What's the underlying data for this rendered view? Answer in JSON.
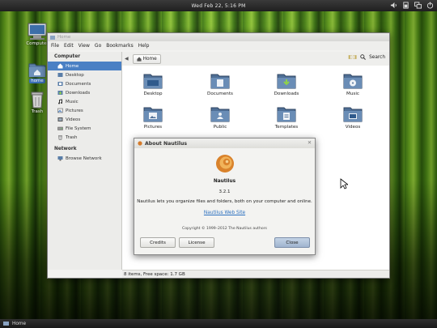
{
  "top_panel": {
    "clock": "Wed Feb 22,  5:16 PM",
    "tray_icons": [
      "volume-icon",
      "battery-icon",
      "network-icon",
      "power-icon"
    ]
  },
  "desktop": {
    "icons": [
      {
        "label": "Computer",
        "icon": "computer-icon",
        "selected": false
      },
      {
        "label": "home",
        "icon": "home-folder-icon",
        "selected": true
      },
      {
        "label": "Trash",
        "icon": "trash-icon",
        "selected": false
      }
    ]
  },
  "window": {
    "title": "Home",
    "menu": [
      "File",
      "Edit",
      "View",
      "Go",
      "Bookmarks",
      "Help"
    ],
    "sidebar": {
      "sections": [
        {
          "heading": "Computer",
          "items": [
            {
              "label": "Home",
              "icon": "home-icon",
              "selected": true
            },
            {
              "label": "Desktop",
              "icon": "desktop-icon",
              "selected": false
            },
            {
              "label": "Documents",
              "icon": "documents-icon",
              "selected": false
            },
            {
              "label": "Downloads",
              "icon": "downloads-icon",
              "selected": false
            },
            {
              "label": "Music",
              "icon": "music-icon",
              "selected": false
            },
            {
              "label": "Pictures",
              "icon": "pictures-icon",
              "selected": false
            },
            {
              "label": "Videos",
              "icon": "videos-icon",
              "selected": false
            },
            {
              "label": "File System",
              "icon": "drive-icon",
              "selected": false
            },
            {
              "label": "Trash",
              "icon": "trash-icon",
              "selected": false
            }
          ]
        },
        {
          "heading": "Network",
          "items": [
            {
              "label": "Browse Network",
              "icon": "network-icon",
              "selected": false
            }
          ]
        }
      ]
    },
    "toolbar": {
      "breadcrumb": "Home",
      "search_label": "Search"
    },
    "folders": [
      {
        "label": "Desktop",
        "icon": "desktop-folder-icon"
      },
      {
        "label": "Documents",
        "icon": "documents-folder-icon"
      },
      {
        "label": "Downloads",
        "icon": "downloads-folder-icon"
      },
      {
        "label": "Music",
        "icon": "music-folder-icon"
      },
      {
        "label": "Pictures",
        "icon": "pictures-folder-icon"
      },
      {
        "label": "Public",
        "icon": "public-folder-icon"
      },
      {
        "label": "Templates",
        "icon": "templates-folder-icon"
      },
      {
        "label": "Videos",
        "icon": "videos-folder-icon"
      }
    ],
    "status": "8 items, Free space: 1.7 GB"
  },
  "about_dialog": {
    "title": "About Nautilus",
    "app_name": "Nautilus",
    "version": "3.2.1",
    "description": "Nautilus lets you organize files and folders, both on your computer and online.",
    "website": "Nautilus Web Site",
    "copyright": "Copyright © 1999–2012 The Nautilus authors",
    "buttons": {
      "credits": "Credits",
      "license": "License",
      "close": "Close"
    }
  },
  "bottom_panel": {
    "task": "Home"
  },
  "colors": {
    "selection": "#4a80c4",
    "link": "#2a6fbf",
    "folder_blue": "#5a7ea8"
  }
}
